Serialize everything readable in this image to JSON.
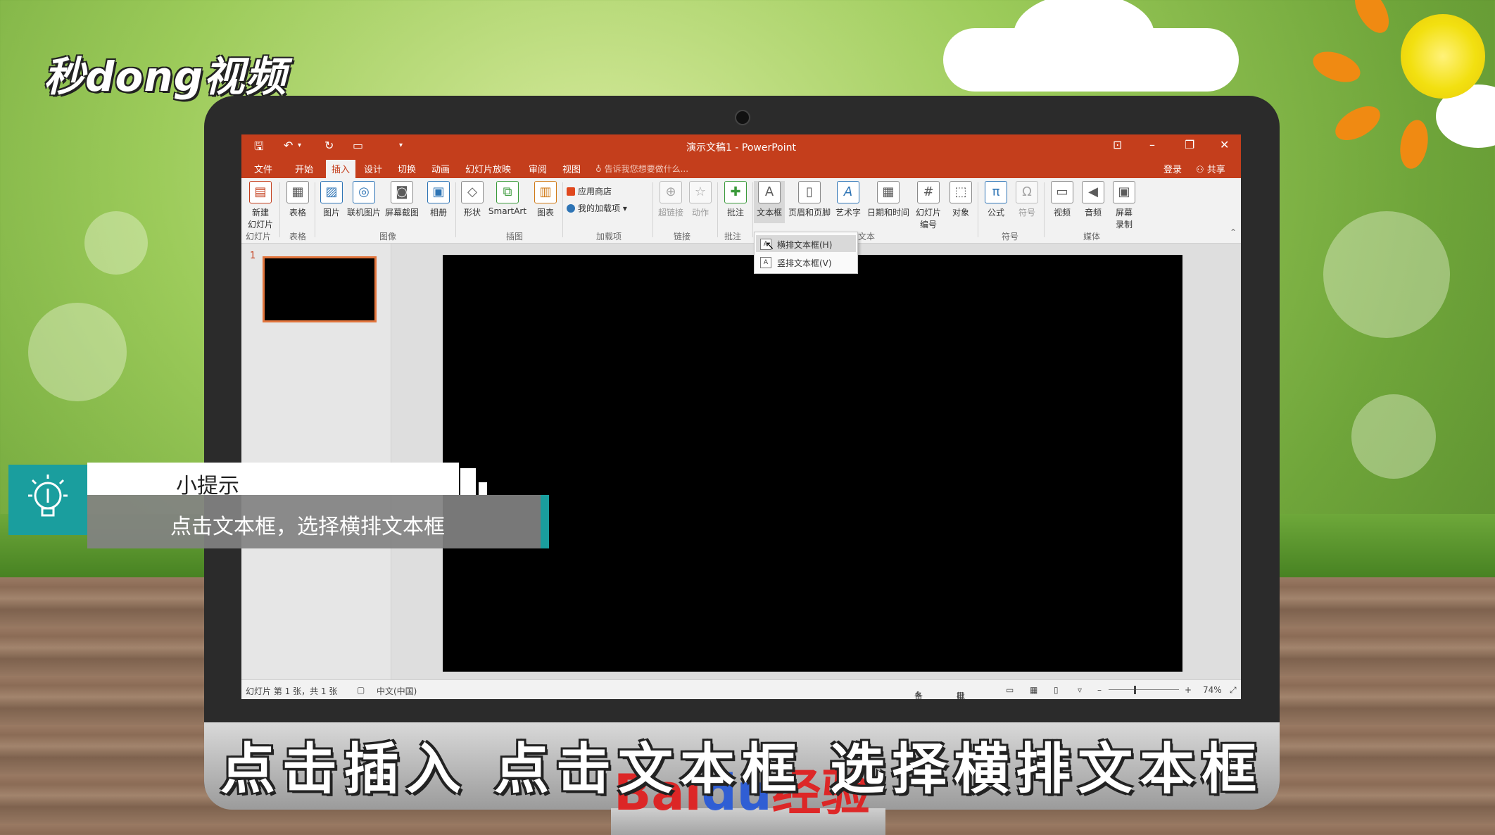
{
  "watermark": {
    "logo_text": "秒dong视频",
    "baidu_brand": "Bai",
    "baidu_paw": "du",
    "baidu_suffix": "经验"
  },
  "window": {
    "title": "演示文稿1 - PowerPoint"
  },
  "menu": {
    "tabs": [
      "文件",
      "开始",
      "插入",
      "设计",
      "切换",
      "动画",
      "幻灯片放映",
      "审阅",
      "视图"
    ],
    "active_tab": "插入",
    "tell_me": "告诉我您想要做什么...",
    "login": "登录",
    "share": "共享"
  },
  "ribbon": {
    "new_slide": "新建\n幻灯片",
    "table": "表格",
    "picture": "图片",
    "online_picture": "联机图片",
    "screenshot": "屏幕截图",
    "album": "相册",
    "shapes": "形状",
    "smartart": "SmartArt",
    "chart": "图表",
    "app_store": "应用商店",
    "my_addins": "我的加载项",
    "hyperlink": "超链接",
    "action": "动作",
    "comment": "批注",
    "textbox": "文本框",
    "header_footer": "页眉和页脚",
    "wordart": "艺术字",
    "datetime": "日期和时间",
    "slide_number": "幻灯片\n编号",
    "object": "对象",
    "equation": "公式",
    "symbol": "符号",
    "video": "视频",
    "audio": "音频",
    "screen_recording": "屏幕\n录制",
    "groups": {
      "slides": "幻灯片",
      "tables": "表格",
      "images": "图像",
      "illustrations": "插图",
      "addins": "加载项",
      "links": "链接",
      "comments": "批注",
      "text": "文本",
      "symbols": "符号",
      "media": "媒体"
    }
  },
  "dropdown": {
    "horizontal_textbox": "横排文本框(H)",
    "vertical_textbox": "竖排文本框(V)"
  },
  "thumbnails": {
    "slide_number": "1"
  },
  "statusbar": {
    "slide_info": "幻灯片 第 1 张，共 1 张",
    "language": "中文(中国)",
    "notes": "备注",
    "comments": "批注",
    "zoom": "74%"
  },
  "tip": {
    "heading": "小提示",
    "body": "点击文本框，选择横排文本框"
  },
  "subtitle": "点击插入 点击文本框 选择横排文本框",
  "colors": {
    "ppt_accent": "#c43e1c",
    "tip_teal": "#1a9e9e"
  },
  "icons": [
    "save-icon",
    "undo-icon",
    "redo-icon",
    "lightbulb-icon",
    "user-icon",
    "restore-icon",
    "minimize-icon",
    "maximize-icon",
    "close-icon"
  ]
}
